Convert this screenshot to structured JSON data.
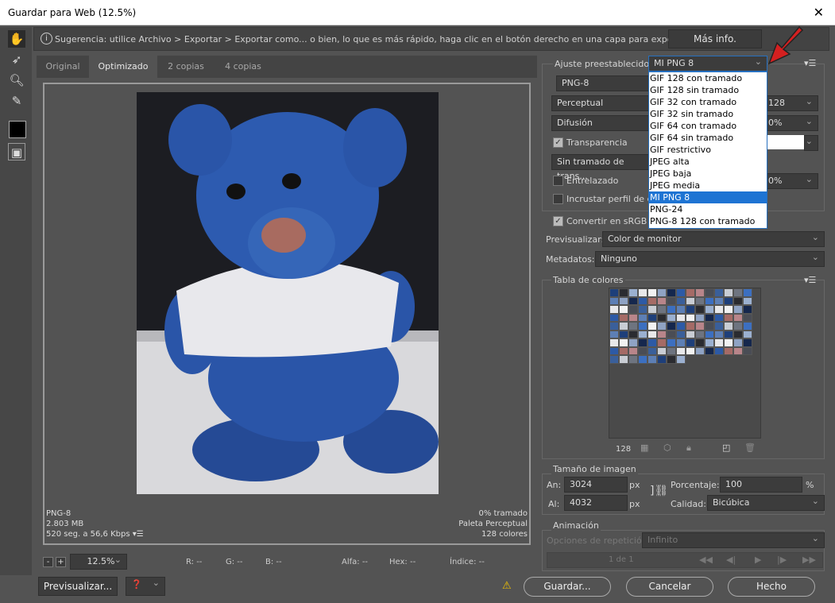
{
  "window": {
    "title": "Guardar para Web (12.5%)"
  },
  "hint": {
    "text": "Sugerencia: utilice Archivo > Exportar > Exportar como... o bien, lo que es más rápido, haga clic en el botón derecho en una capa para exportar los recursos",
    "more_info": "Más info."
  },
  "tabs": [
    {
      "label": "Original"
    },
    {
      "label": "Optimizado"
    },
    {
      "label": "2 copias"
    },
    {
      "label": "4 copias"
    }
  ],
  "image_info": {
    "format": "PNG-8",
    "size": "2.803 MB",
    "time": "520 seg. a 56,6 Kbps",
    "dither": "0% tramado",
    "palette": "Paleta Perceptual",
    "colors": "128 colores"
  },
  "statusbar": {
    "zoom": "12.5%",
    "r": "R: --",
    "g": "G: --",
    "b": "B: --",
    "alpha": "Alfa: --",
    "hex": "Hex: --",
    "index": "Índice: --"
  },
  "bottom": {
    "preview": "Previsualizar...",
    "save": "Guardar...",
    "cancel": "Cancelar",
    "done": "Hecho"
  },
  "settings": {
    "preset_label": "Ajuste preestablecido:",
    "preset_value": "MI PNG 8",
    "format": "PNG-8",
    "reduction": "Perceptual",
    "colors": "128",
    "dither_algo": "Difusión",
    "dither": "0%",
    "transparency": "Transparencia",
    "transparency_checked": true,
    "matte_dither": "Sin tramado de trans...",
    "interlaced": "Entrelazado",
    "interlaced_checked": false,
    "lossy": "0%",
    "embed": "Incrustar perfil de color",
    "embed_checked": false,
    "srgb": "Convertir en sRGB",
    "srgb_checked": true,
    "preview_label": "Previsualizar:",
    "preview_value": "Color de monitor",
    "metadata_label": "Metadatos:",
    "metadata_value": "Ninguno"
  },
  "preset_menu": [
    "GIF 128 con tramado",
    "GIF 128 sin tramado",
    "GIF 32 con tramado",
    "GIF 32 sin tramado",
    "GIF 64 con tramado",
    "GIF 64 sin tramado",
    "GIF restrictivo",
    "JPEG alta",
    "JPEG baja",
    "JPEG media",
    "MI PNG 8",
    "PNG-24",
    "PNG-8 128 con tramado"
  ],
  "color_table": {
    "title": "Tabla de colores",
    "count": "128",
    "palette": [
      "#1e3f7a",
      "#2d5aa6",
      "#3c6fc0",
      "#8fa3c4",
      "#c9cdd4",
      "#e8e8ea",
      "#4a4d55",
      "#2a2b30",
      "#a56b66",
      "#5d7fb5",
      "#15274d",
      "#6e7480",
      "#f2f2f2",
      "#3a5f9a",
      "#9bb0d0",
      "#b8858a"
    ]
  },
  "image_size": {
    "title": "Tamaño de imagen",
    "w_label": "An:",
    "w": "3024",
    "h_label": "Al:",
    "h": "4032",
    "unit": "px",
    "pct_label": "Porcentaje:",
    "pct": "100",
    "pct_unit": "%",
    "quality_label": "Calidad:",
    "quality": "Bicúbica"
  },
  "animation": {
    "title": "Animación",
    "loop_label": "Opciones de repetición:",
    "loop": "Infinito",
    "frame": "1 de 1"
  },
  "colors": {
    "accent": "#1e74d3",
    "arrow": "#d42020"
  }
}
